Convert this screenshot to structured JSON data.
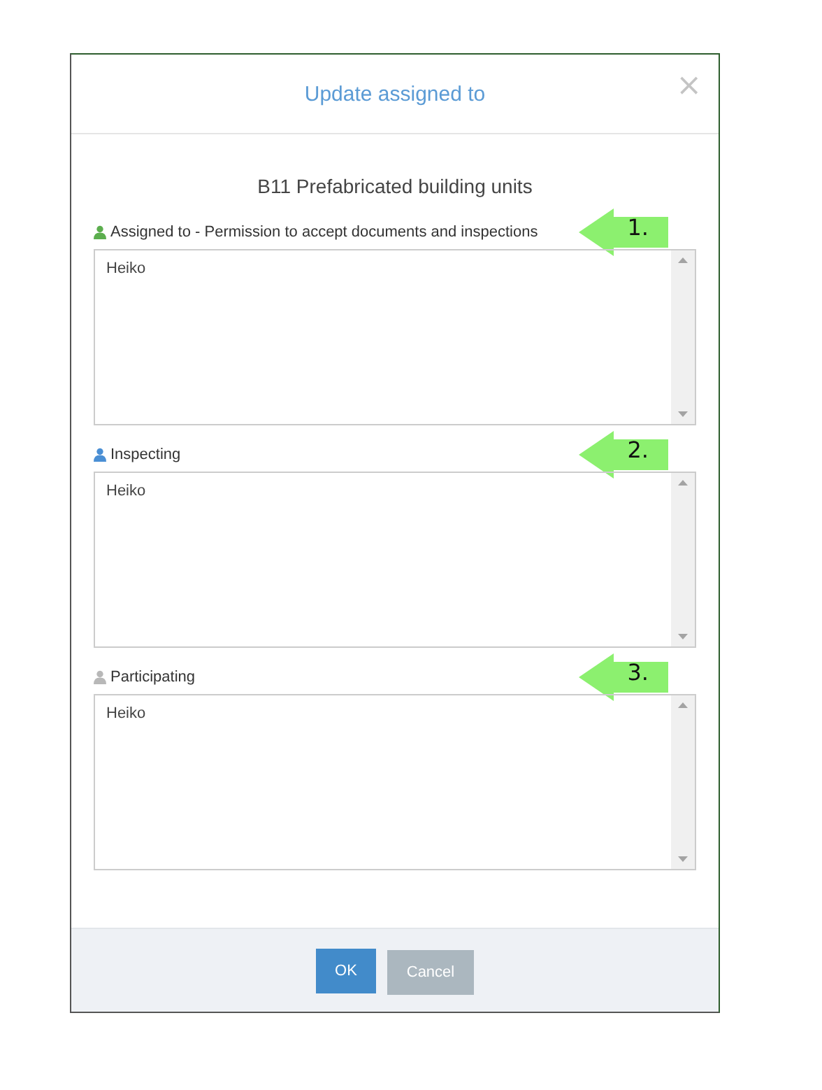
{
  "dialog": {
    "title": "Update assigned to",
    "close": "×"
  },
  "subtitle": "B11 Prefabricated building units",
  "fields": [
    {
      "label": "Assigned to - Permission to accept documents and inspections",
      "color": "#5cae4e",
      "value": "Heiko",
      "annotation": "1."
    },
    {
      "label": "Inspecting",
      "color": "#4a8fd4",
      "value": "Heiko",
      "annotation": "2."
    },
    {
      "label": "Participating",
      "color": "#b8b8b8",
      "value": "Heiko",
      "annotation": "3."
    }
  ],
  "buttons": [
    {
      "label": "OK",
      "kind": "primary"
    },
    {
      "label": "Cancel",
      "kind": "secondary"
    }
  ]
}
